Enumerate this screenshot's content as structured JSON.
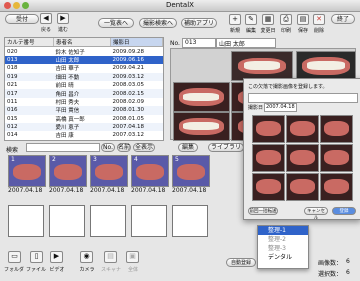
{
  "window": {
    "title": "DentalX"
  },
  "toolbar": {
    "receive_label": "受付",
    "back_label": "戻る",
    "forward_label": "進む",
    "list_menu_label": "一覧表へ",
    "findings_menu_label": "撮影検索へ",
    "auxiliary_app_label": "補助アプリ",
    "new_label": "新規",
    "edit_label": "編集",
    "change_label": "変更日",
    "print_label": "印刷",
    "save_label": "保存",
    "delete_label": "削除",
    "end_label": "終了"
  },
  "patient_table": {
    "headers": [
      "カルテ番号",
      "患者名",
      "撮影日"
    ],
    "rows": [
      {
        "id": "020",
        "name": "鈴木 佐知子",
        "date": "2009.09.28"
      },
      {
        "id": "013",
        "name": "山田 太郎",
        "date": "2009.06.16"
      },
      {
        "id": "018",
        "name": "吉田 華子",
        "date": "2009.04.21"
      },
      {
        "id": "019",
        "name": "畑田 不動",
        "date": "2009.03.12"
      },
      {
        "id": "021",
        "name": "前田 晴",
        "date": "2008.03.05"
      },
      {
        "id": "017",
        "name": "角田 昌介",
        "date": "2008.02.15"
      },
      {
        "id": "011",
        "name": "村田 秀夫",
        "date": "2008.02.09"
      },
      {
        "id": "016",
        "name": "平田 貴信",
        "date": "2008.01.30"
      },
      {
        "id": "015",
        "name": "高橋 真一郎",
        "date": "2008.01.05"
      },
      {
        "id": "012",
        "name": "愛川 恵子",
        "date": "2007.04.18"
      },
      {
        "id": "014",
        "name": "吉田 康",
        "date": "2007.03.12"
      }
    ],
    "selected_index": 1
  },
  "patient_header": {
    "no_label": "No.",
    "no_value": "013",
    "name": "山田 太郎"
  },
  "search": {
    "label": "検索",
    "placeholder": "",
    "no_button": "No.",
    "name_button": "名前",
    "all_button": "全表示"
  },
  "viewer_controls": {
    "edit_button": "編集",
    "library_button": "ライブラリ"
  },
  "thumbnails": {
    "items": [
      {
        "index": "1",
        "date": "2007.04.18"
      },
      {
        "index": "2",
        "date": "2007.04.18"
      },
      {
        "index": "3",
        "date": "2007.04.18"
      },
      {
        "index": "4",
        "date": "2007.04.18"
      },
      {
        "index": "5",
        "date": "2007.04.18"
      }
    ]
  },
  "dialog": {
    "instruction": "この欠落で撮影画像を登録します。",
    "date_label": "撮影日",
    "date_value": "2007.04.18",
    "close_button": "前回一括転送",
    "cancel_button": "キャンセル",
    "ok_button": "登録"
  },
  "popup_menu": {
    "items": [
      "整理-1",
      "整理-2",
      "整理-3",
      "デンタル"
    ],
    "selected_index": 0
  },
  "bottom_bar": {
    "folder_label": "フォルダ",
    "file_label": "ファイル",
    "video_label": "ビデオ",
    "camera_label": "カメラ",
    "scanner_label": "スキャナ",
    "whole_label": "全体",
    "auto_register_label": "自動登録",
    "image_count_label": "画像数：",
    "image_count_value": "6",
    "selected_count_label": "選択数：",
    "selected_count_value": "6"
  },
  "colors": {
    "selection": "#2f63c9",
    "thumb_bg": "#5a5aa8",
    "accent_red": "#c8372f"
  }
}
